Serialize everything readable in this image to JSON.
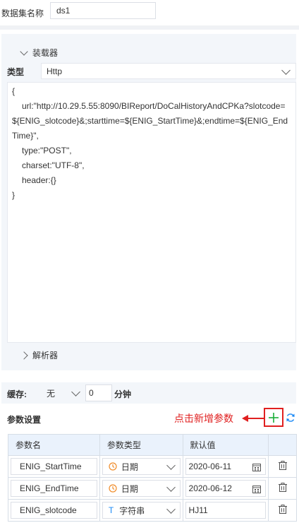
{
  "dataset": {
    "name_label": "数据集名称",
    "name_value": "ds1"
  },
  "loader": {
    "title": "装载器",
    "type_label": "类型",
    "type_value": "Http",
    "code_lines": [
      "{",
      "url:\"http://10.29.5.55:8090/BIReport/DoCalHistoryAndCPKa?slotcode=${ENIG_slotcode}&;starttime=${ENIG_StartTime}&;endtime=${ENIG_EndTime}\",",
      "type:\"POST\",",
      "charset:\"UTF-8\",",
      "header:{}",
      "}"
    ]
  },
  "parser": {
    "title": "解析器"
  },
  "cache": {
    "label": "缓存:",
    "select_value": "无",
    "number_value": "0",
    "unit": "分钟"
  },
  "params": {
    "title": "参数设置",
    "annotation": "点击新增参数",
    "columns": [
      "参数名",
      "参数类型",
      "默认值"
    ],
    "rows": [
      {
        "name": "ENIG_StartTime",
        "type": "日期",
        "type_icon": "clock-icon",
        "default": "2020-06-11",
        "has_calendar": true
      },
      {
        "name": "ENIG_EndTime",
        "type": "日期",
        "type_icon": "clock-icon",
        "default": "2020-06-12",
        "has_calendar": true
      },
      {
        "name": "ENIG_slotcode",
        "type": "字符串",
        "type_icon": "text-type-icon",
        "default": "HJ11",
        "has_calendar": false
      }
    ]
  },
  "colors": {
    "accent": "#1c8af5",
    "annotation": "#e02020",
    "add": "#1aae3a"
  }
}
